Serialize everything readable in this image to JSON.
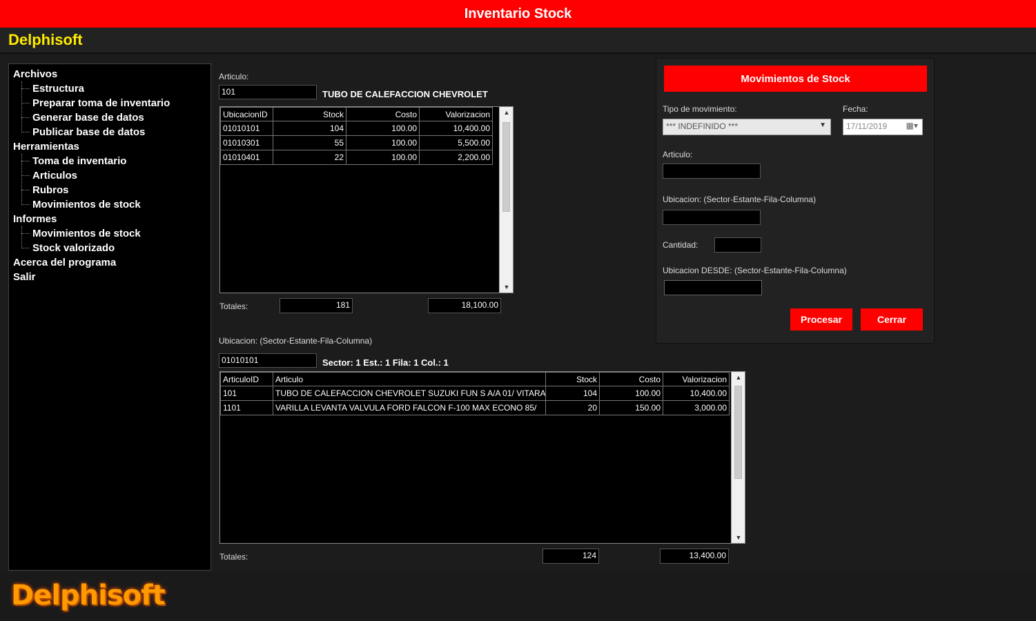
{
  "window": {
    "title": "Inventario Stock"
  },
  "brand": {
    "name": "Delphisoft"
  },
  "menu": {
    "groups": [
      {
        "label": "Archivos",
        "items": [
          "Estructura",
          "Preparar toma de inventario",
          "Generar base de datos",
          "Publicar base de datos"
        ]
      },
      {
        "label": "Herramientas",
        "items": [
          "Toma de inventario",
          "Articulos",
          "Rubros",
          "Movimientos de stock"
        ]
      },
      {
        "label": "Informes",
        "items": [
          "Movimientos de stock",
          "Stock valorizado"
        ]
      }
    ],
    "extra": [
      "Acerca del programa",
      "Salir"
    ]
  },
  "articulo_panel": {
    "articulo_label": "Articulo:",
    "articulo_value": "101",
    "articulo_desc": "TUBO DE CALEFACCION CHEVROLET",
    "columns": [
      "UbicacionID",
      "Stock",
      "Costo",
      "Valorizacion"
    ],
    "rows": [
      [
        "01010101",
        "104",
        "100.00",
        "10,400.00"
      ],
      [
        "01010301",
        "55",
        "100.00",
        "5,500.00"
      ],
      [
        "01010401",
        "22",
        "100.00",
        "2,200.00"
      ]
    ],
    "totales_label": "Totales:",
    "total_stock": "181",
    "total_valor": "18,100.00"
  },
  "ubicacion_panel": {
    "ubicacion_label": "Ubicacion: (Sector-Estante-Fila-Columna)",
    "ubicacion_value": "01010101",
    "ubicacion_desc": "Sector: 1 Est.: 1 Fila: 1 Col.: 1",
    "columns": [
      "ArticuloID",
      "Articulo",
      "Stock",
      "Costo",
      "Valorizacion"
    ],
    "rows": [
      [
        "101",
        "TUBO DE CALEFACCION CHEVROLET SUZUKI FUN S A/A 01/ VITARA",
        "104",
        "100.00",
        "10,400.00"
      ],
      [
        "1101",
        "VARILLA LEVANTA VALVULA FORD FALCON F-100 MAX ECONO 85/",
        "20",
        "150.00",
        "3,000.00"
      ]
    ],
    "totales_label": "Totales:",
    "total_stock": "124",
    "total_valor": "13,400.00"
  },
  "dialog": {
    "title": "Movimientos de Stock",
    "tipo_label": "Tipo de movimiento:",
    "tipo_value": "*** INDEFINIDO ***",
    "fecha_label": "Fecha:",
    "fecha_value": "17/11/2019",
    "articulo_label": "Articulo:",
    "articulo_value": "",
    "ubicacion_label": "Ubicacion: (Sector-Estante-Fila-Columna)",
    "ubicacion_value": "",
    "cantidad_label": "Cantidad:",
    "cantidad_value": "",
    "desde_label": "Ubicacion DESDE: (Sector-Estante-Fila-Columna)",
    "desde_value": "",
    "procesar_label": "Procesar",
    "cerrar_label": "Cerrar"
  },
  "footer": {
    "logo": "Delphisoft"
  },
  "colors": {
    "accent": "#ff0000",
    "brand_yellow": "#ffea00",
    "logo_orange": "#ff9a00"
  }
}
